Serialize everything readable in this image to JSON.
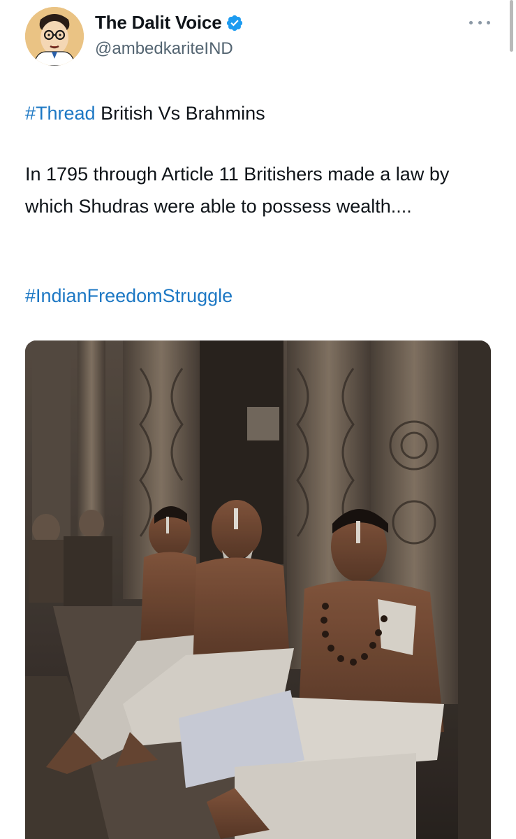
{
  "tweet": {
    "author": {
      "display_name": "The Dalit Voice",
      "handle": "@ambedkariteIND",
      "verified_icon": "verified-badge-icon",
      "avatar_icon": "caricature-avatar"
    },
    "more_icon": "more-horizontal-icon",
    "hashtag_thread": "#Thread",
    "title_text": " British Vs Brahmins",
    "body": "In 1795 through Article 11 Britishers made a law by which Shudras were able to possess wealth....",
    "hashtag_freedom": "#IndianFreedomStruggle",
    "media_icon": "photo-temple-priests"
  },
  "colors": {
    "hashtag": "#1d78c4",
    "verified": "#1d9bf0",
    "secondary_text": "#536471"
  }
}
